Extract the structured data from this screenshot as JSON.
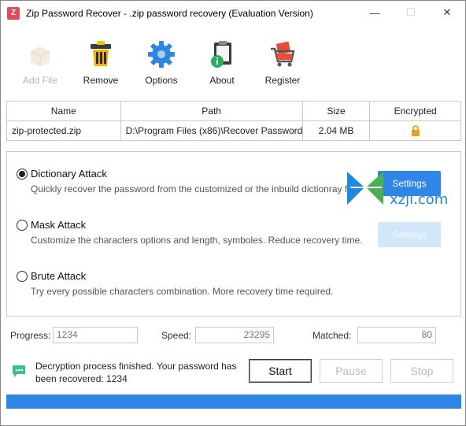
{
  "window": {
    "title": "Zip Password Recover - .zip password recovery (Evaluation Version)",
    "app_icon_glyph": "Z",
    "controls": {
      "minimize": "—",
      "maximize": "☐",
      "close": "✕"
    }
  },
  "toolbar": {
    "items": [
      {
        "label": "Add File",
        "icon": "add-file-icon",
        "enabled": false
      },
      {
        "label": "Remove",
        "icon": "trash-icon",
        "enabled": true
      },
      {
        "label": "Options",
        "icon": "gear-icon",
        "enabled": true
      },
      {
        "label": "About",
        "icon": "info-clipboard-icon",
        "enabled": true
      },
      {
        "label": "Register",
        "icon": "cart-icon",
        "enabled": true
      }
    ]
  },
  "file_table": {
    "columns": [
      "Name",
      "Path",
      "Size",
      "Encrypted"
    ],
    "rows": [
      {
        "name": "zip-protected.zip",
        "path": "D:\\Program Files (x86)\\Recover Password",
        "size": "2.04 MB",
        "encrypted": "lock-icon"
      }
    ]
  },
  "attacks": {
    "selected": "dictionary",
    "options": [
      {
        "id": "dictionary",
        "title": "Dictionary Attack",
        "desc": "Quickly recover the password from the customized or the inbuild dictionray file."
      },
      {
        "id": "mask",
        "title": "Mask Attack",
        "desc": "Customize the characters options and length, symboles. Reduce recovery time."
      },
      {
        "id": "brute",
        "title": "Brute Attack",
        "desc": "Try every possible characters combination. More recovery time required."
      }
    ],
    "settings_label": "Settings"
  },
  "watermark": {
    "text": "xzji.com"
  },
  "stats": {
    "progress_label": "Progress:",
    "progress_value": "1234",
    "speed_label": "Speed:",
    "speed_value": "23295",
    "matched_label": "Matched:",
    "matched_value": "80"
  },
  "status": {
    "message": "Decryption process finished. Your password has been recovered: 1234"
  },
  "actions": {
    "start": "Start",
    "pause": "Pause",
    "stop": "Stop"
  },
  "progress_fraction": 1.0,
  "colors": {
    "accent": "#2f86e6",
    "accent_light": "#d3e7fb",
    "status_green": "#3bbf8a",
    "lock": "#f39c12"
  }
}
